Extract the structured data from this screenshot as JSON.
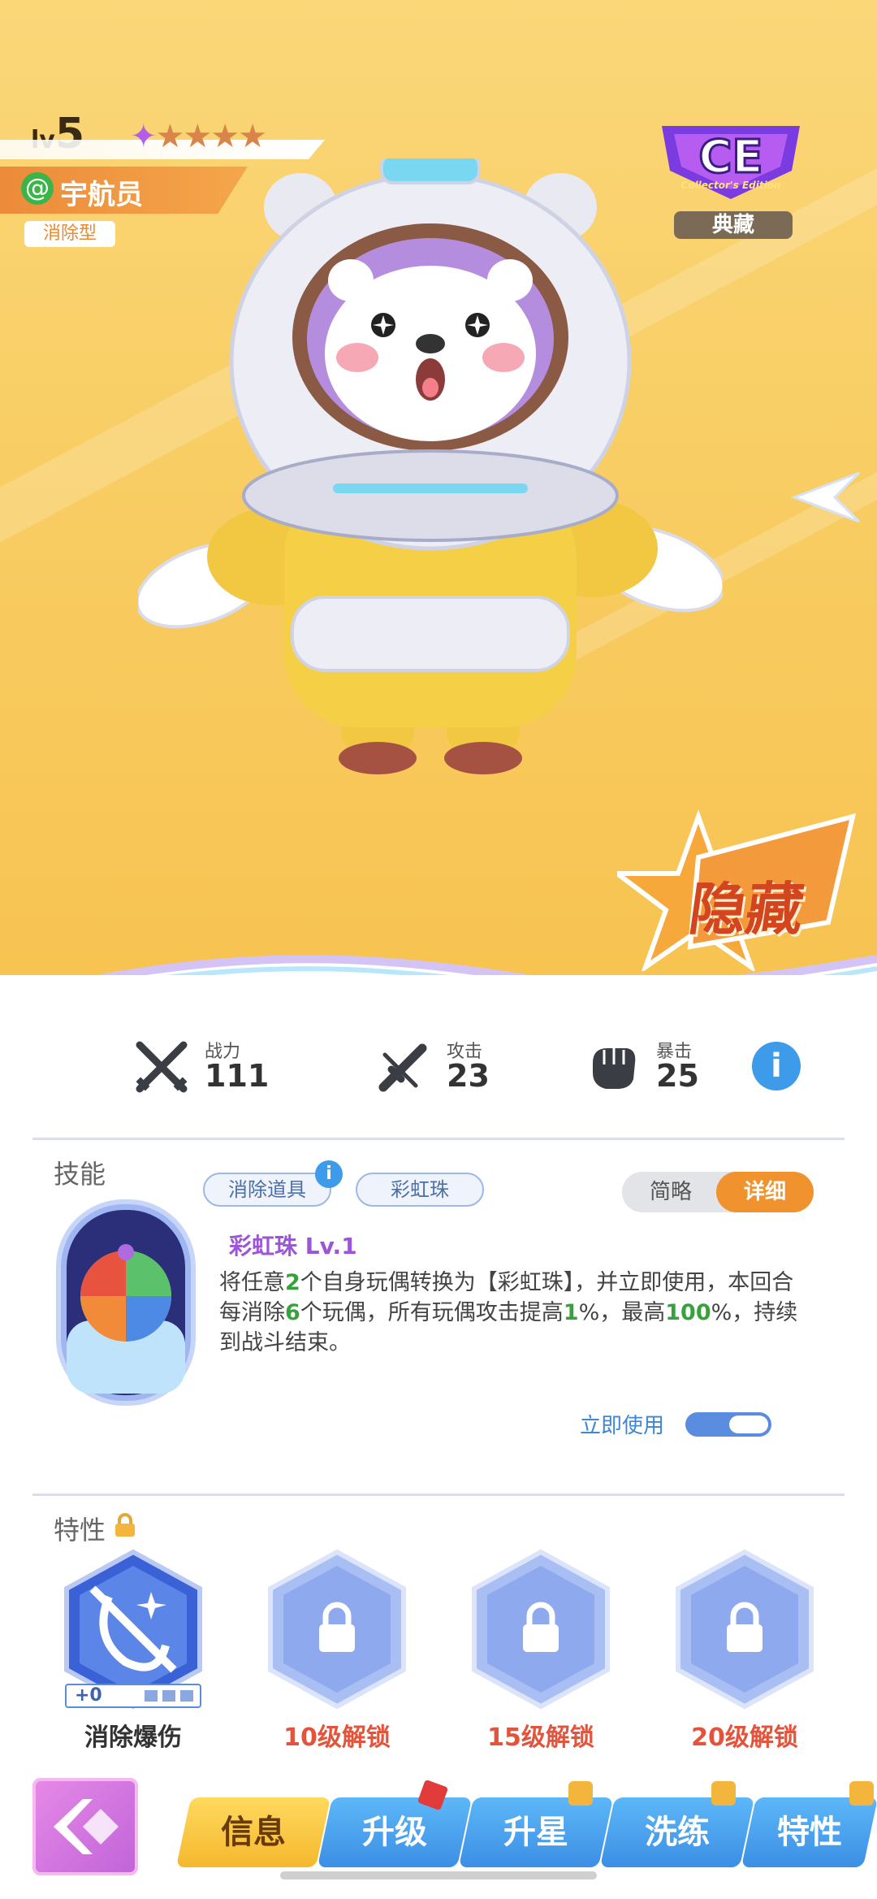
{
  "header": {
    "level_prefix": "lv",
    "level": "5",
    "stars_total": 5,
    "character_name": "宇航员",
    "character_type": "消除型",
    "edition_logo": "CE",
    "edition_subtext": "Collector's Edition",
    "edition_label": "典藏",
    "hidden_badge": "隐藏"
  },
  "stats": [
    {
      "label": "战力",
      "value": "111",
      "icon": "crossed-swords-icon"
    },
    {
      "label": "攻击",
      "value": "23",
      "icon": "sword-icon"
    },
    {
      "label": "暴击",
      "value": "25",
      "icon": "fist-icon"
    }
  ],
  "stats_info": "i",
  "skill": {
    "section_title": "技能",
    "tags": [
      "消除道具",
      "彩虹珠"
    ],
    "tag_info": "i",
    "toggle": {
      "brief": "简略",
      "detail": "详细",
      "selected": "详细"
    },
    "name": "彩虹珠 Lv.1",
    "desc_parts": [
      {
        "t": "将任意",
        "hl": false
      },
      {
        "t": "2",
        "hl": true
      },
      {
        "t": "个自身玩偶转换为【彩虹珠】，并立即使用，本回合每消除",
        "hl": false
      },
      {
        "t": "6",
        "hl": true
      },
      {
        "t": "个玩偶，所有玩偶攻击提高",
        "hl": false
      },
      {
        "t": "1",
        "hl": true
      },
      {
        "t": "%，最高",
        "hl": false
      },
      {
        "t": "100",
        "hl": true
      },
      {
        "t": "%，持续到战斗结束。",
        "hl": false
      }
    ],
    "use_now": "立即使用",
    "use_now_on": true
  },
  "traits": {
    "section_title": "特性",
    "items": [
      {
        "label": "消除爆伤",
        "level_text": "+0",
        "locked": false
      },
      {
        "label": "10级解锁",
        "locked": true
      },
      {
        "label": "15级解锁",
        "locked": true
      },
      {
        "label": "20级解锁",
        "locked": true
      }
    ]
  },
  "nav": {
    "tabs": [
      {
        "label": "信息",
        "active": true,
        "locked": false,
        "badge": false
      },
      {
        "label": "升级",
        "active": false,
        "locked": true,
        "badge": true
      },
      {
        "label": "升星",
        "active": false,
        "locked": true,
        "badge": false
      },
      {
        "label": "洗练",
        "active": false,
        "locked": true,
        "badge": false
      },
      {
        "label": "特性",
        "active": false,
        "locked": true,
        "badge": false
      }
    ]
  },
  "colors": {
    "accent_orange": "#f0932f",
    "accent_blue": "#3d9bea",
    "highlight_green": "#39a13c",
    "lock_red": "#e2543c"
  }
}
